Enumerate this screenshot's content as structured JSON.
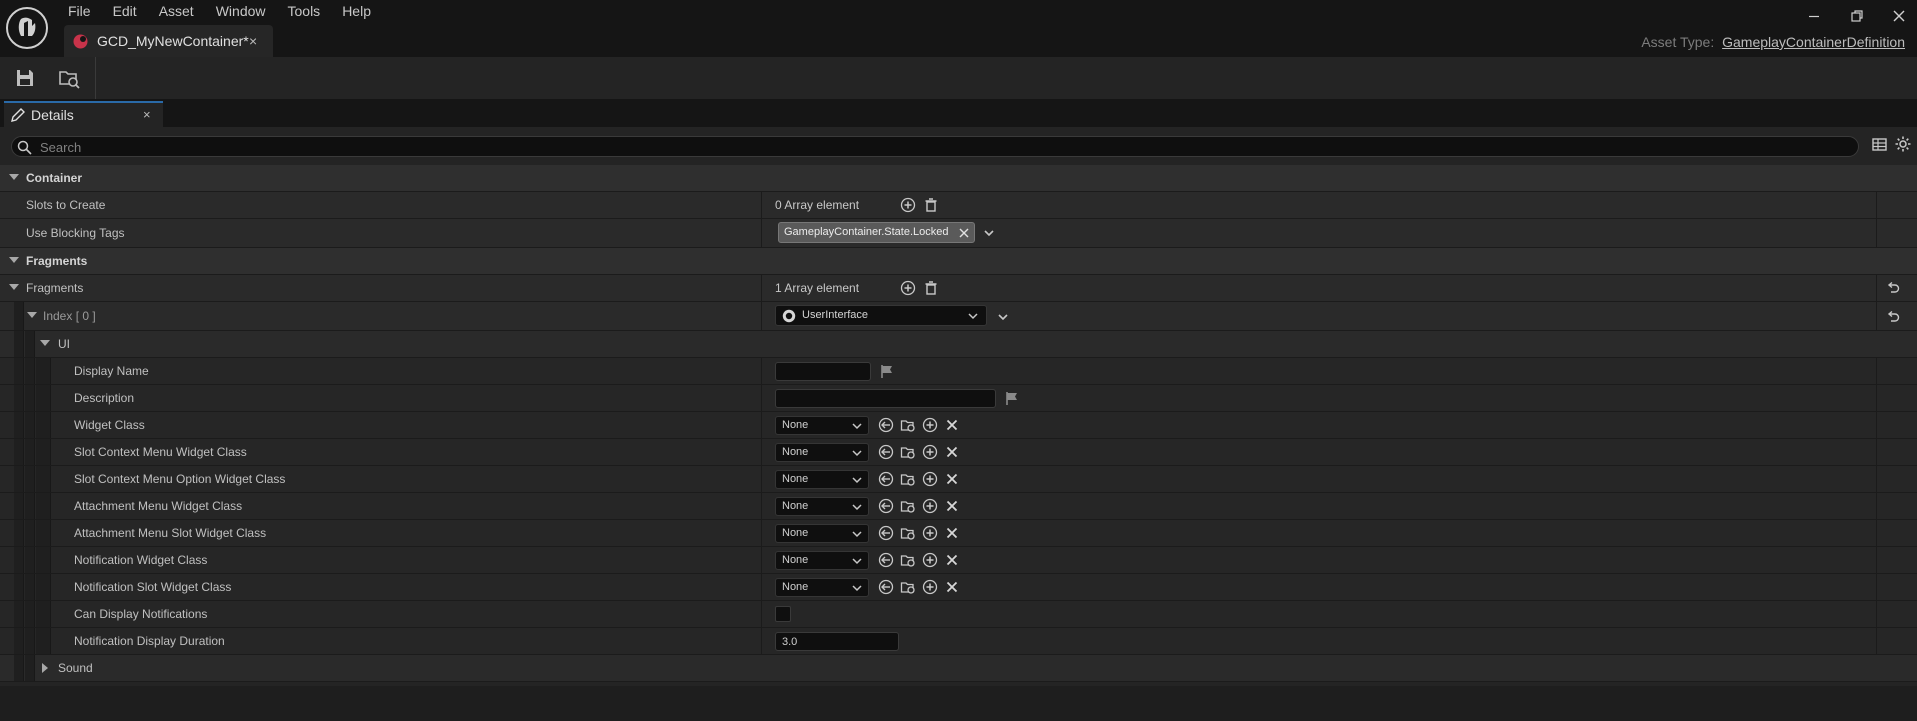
{
  "menu": [
    "File",
    "Edit",
    "Asset",
    "Window",
    "Tools",
    "Help"
  ],
  "document_tab": {
    "label": "GCD_MyNewContainer*",
    "close": "×"
  },
  "asset_type": {
    "label": "Asset Type:",
    "value": "GameplayContainerDefinition"
  },
  "details_tab": {
    "label": "Details",
    "close": "×"
  },
  "search": {
    "placeholder": "Search",
    "value": ""
  },
  "categories": {
    "container": "Container",
    "fragments": "Fragments",
    "ui": "UI",
    "sound": "Sound"
  },
  "container": {
    "slots_to_create": {
      "label": "Slots to Create",
      "value": "0 Array element"
    },
    "use_blocking_tags": {
      "label": "Use Blocking Tags",
      "tag": "GameplayContainer.State.Locked"
    }
  },
  "fragments": {
    "label": "Fragments",
    "value": "1 Array element",
    "index_label": "Index [ 0 ]",
    "index_value": "UserInterface"
  },
  "ui": {
    "display_name": {
      "label": "Display Name",
      "value": ""
    },
    "description": {
      "label": "Description",
      "value": ""
    },
    "widget_class": {
      "label": "Widget Class",
      "value": "None"
    },
    "slot_context_menu_widget_class": {
      "label": "Slot Context Menu Widget Class",
      "value": "None"
    },
    "slot_context_menu_option_widget_class": {
      "label": "Slot Context Menu Option Widget Class",
      "value": "None"
    },
    "attachment_menu_widget_class": {
      "label": "Attachment Menu Widget Class",
      "value": "None"
    },
    "attachment_menu_slot_widget_class": {
      "label": "Attachment Menu Slot Widget Class",
      "value": "None"
    },
    "notification_widget_class": {
      "label": "Notification Widget Class",
      "value": "None"
    },
    "notification_slot_widget_class": {
      "label": "Notification Slot Widget Class",
      "value": "None"
    },
    "can_display_notifications": {
      "label": "Can Display Notifications",
      "checked": false
    },
    "notification_display_duration": {
      "label": "Notification Display Duration",
      "value": "3.0"
    }
  },
  "colors": {
    "accent": "#2a6aa8",
    "tab_icon": "#c8334a",
    "background": "#242424"
  }
}
